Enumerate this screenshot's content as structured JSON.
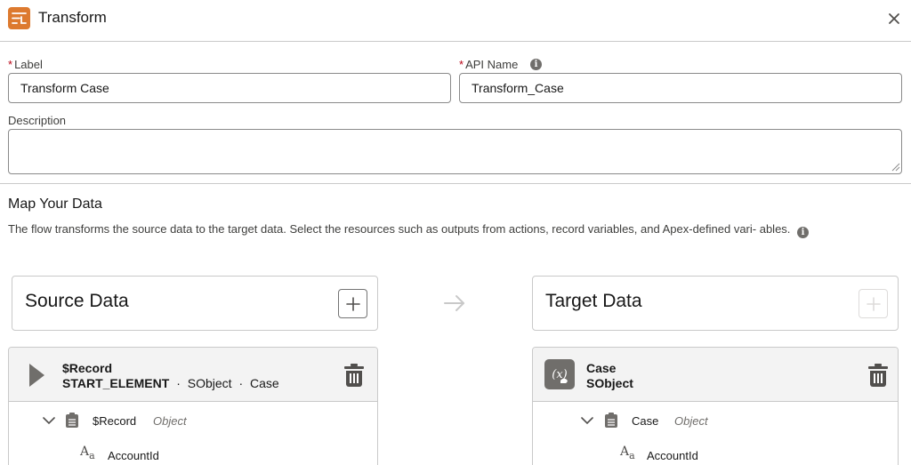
{
  "header": {
    "title": "Transform",
    "app_icon": "transform-icon",
    "close_icon": "close-icon"
  },
  "fields": {
    "required_mark": "*",
    "label": {
      "label": "Label",
      "value": "Transform Case"
    },
    "api_name": {
      "label": "API Name",
      "value": "Transform_Case",
      "info_icon": "info-icon"
    },
    "description": {
      "label": "Description",
      "value": ""
    }
  },
  "map": {
    "title": "Map Your Data",
    "help": "The flow transforms the source data to the target data. Select the resources such as outputs from actions, record variables, and Apex-defined vari- ables.",
    "info_icon": "info-icon"
  },
  "source": {
    "title": "Source Data",
    "add_icon": "plus-icon",
    "object": {
      "name": "$Record",
      "subtitle_parts": [
        "START_ELEMENT",
        "·",
        "SObject",
        "·",
        "Case"
      ],
      "icon": "play-icon",
      "delete_icon": "trash-icon",
      "tree_root": {
        "name": "$Record",
        "type": "Object"
      },
      "fields": [
        "AccountId"
      ]
    }
  },
  "target": {
    "title": "Target Data",
    "add_icon": "plus-icon",
    "add_disabled": true,
    "object": {
      "name": "Case",
      "subtitle": "SObject",
      "icon": "variable-icon",
      "delete_icon": "trash-icon",
      "tree_root": {
        "name": "Case",
        "type": "Object"
      },
      "fields": [
        "AccountId"
      ]
    }
  },
  "icon_glyphs": {
    "info": "i",
    "text_field_big": "A",
    "text_field_small": "a"
  },
  "colors": {
    "brand_orange": "#dd7a2f",
    "required": "#ba0517",
    "border": "#c9c9c9",
    "panel": "#f3f3f3"
  }
}
